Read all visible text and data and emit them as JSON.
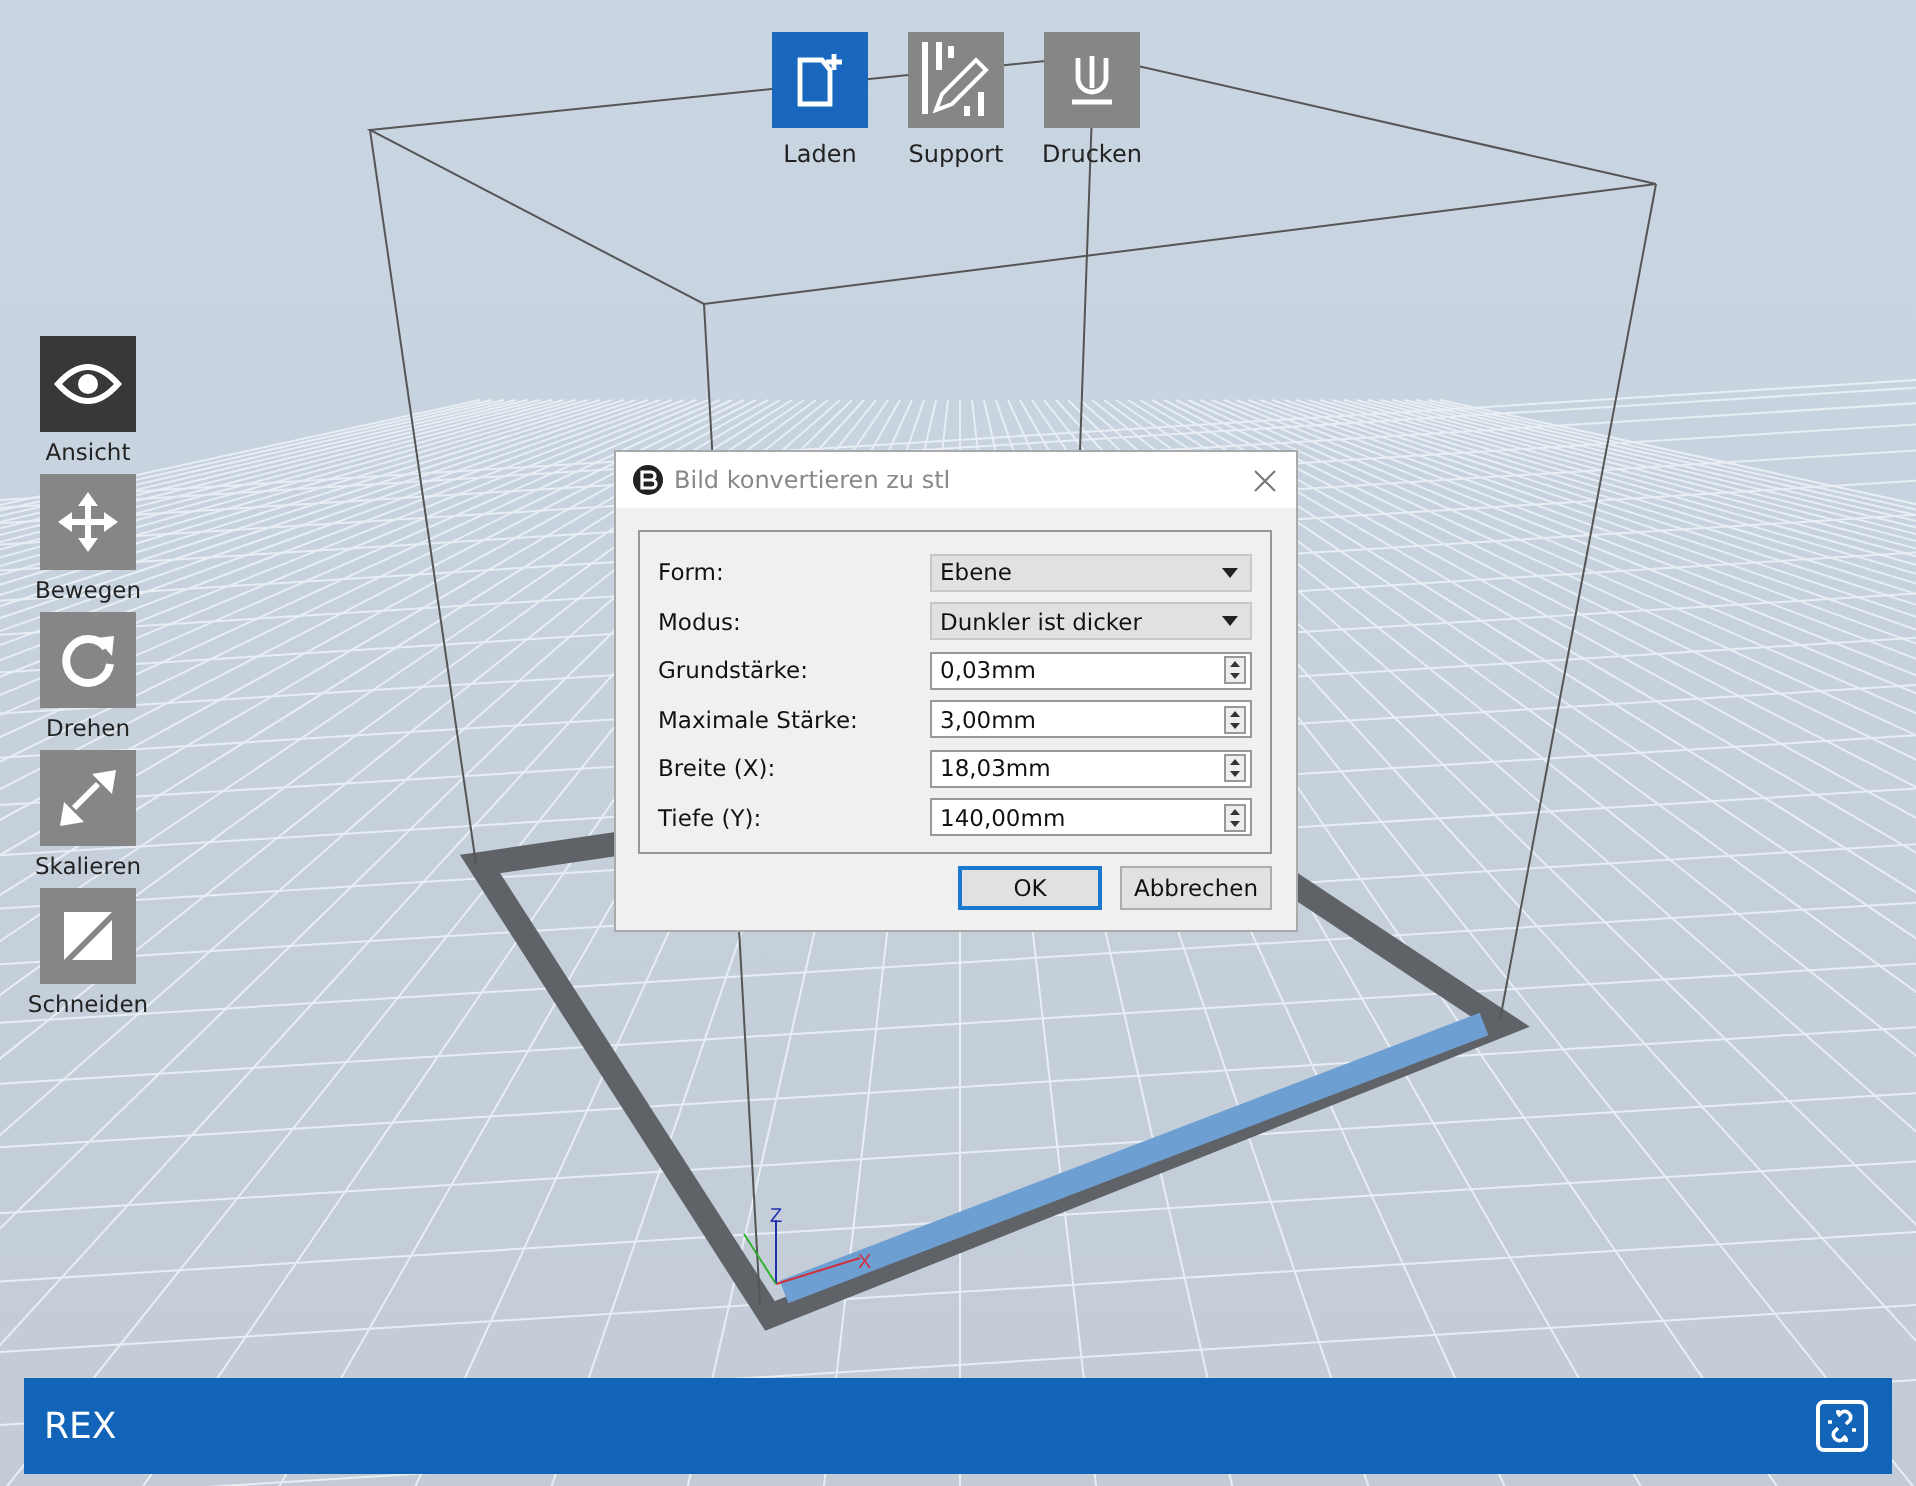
{
  "top_toolbar": [
    {
      "label": "Laden",
      "kind": "load",
      "selected": true
    },
    {
      "label": "Support",
      "kind": "support",
      "selected": false
    },
    {
      "label": "Drucken",
      "kind": "print",
      "selected": false
    }
  ],
  "side_toolbar": [
    {
      "label": "Ansicht",
      "kind": "view",
      "selected": true
    },
    {
      "label": "Bewegen",
      "kind": "move",
      "selected": false
    },
    {
      "label": "Drehen",
      "kind": "rotate",
      "selected": false
    },
    {
      "label": "Skalieren",
      "kind": "scale",
      "selected": false
    },
    {
      "label": "Schneiden",
      "kind": "cut",
      "selected": false
    }
  ],
  "scene": {
    "axis_labels": [
      "Z",
      "X"
    ]
  },
  "dialog": {
    "title": "Bild konvertieren zu stl",
    "fields": [
      {
        "label": "Form:",
        "kind": "dropdown",
        "value": "Ebene"
      },
      {
        "label": "Modus:",
        "kind": "dropdown",
        "value": "Dunkler ist dicker"
      },
      {
        "label": "Grundstärke:",
        "kind": "spinner",
        "value": "0,03mm"
      },
      {
        "label": "Maximale Stärke:",
        "kind": "spinner",
        "value": "3,00mm"
      },
      {
        "label": "Breite (X):",
        "kind": "spinner",
        "value": "18,03mm"
      },
      {
        "label": "Tiefe (Y):",
        "kind": "spinner",
        "value": "140,00mm"
      }
    ],
    "buttons": [
      {
        "label": "OK",
        "default": true
      },
      {
        "label": "Abbrechen",
        "default": false
      }
    ]
  },
  "status_bar": {
    "title": "REX"
  }
}
